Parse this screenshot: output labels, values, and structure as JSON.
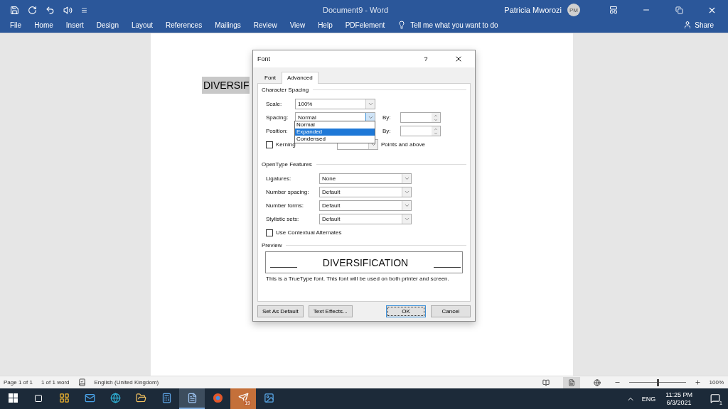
{
  "title_bar": {
    "title": "Document9  -  Word",
    "user": "Patricia Mworozi",
    "avatar": "PM"
  },
  "ribbon_tabs": [
    {
      "label": "File"
    },
    {
      "label": "Home"
    },
    {
      "label": "Insert"
    },
    {
      "label": "Design"
    },
    {
      "label": "Layout"
    },
    {
      "label": "References"
    },
    {
      "label": "Mailings"
    },
    {
      "label": "Review"
    },
    {
      "label": "View"
    },
    {
      "label": "Help"
    },
    {
      "label": "PDFelement"
    }
  ],
  "tell_me": "Tell me what you want to do",
  "share": "Share",
  "document": {
    "text": "DIVERSIF"
  },
  "dialog": {
    "title": "Font",
    "help": "?",
    "tabs": [
      {
        "label": "Font",
        "selected": false
      },
      {
        "label": "Advanced",
        "selected": true
      }
    ],
    "character_spacing": {
      "heading": "Character Spacing",
      "scale": {
        "label": "Scale:",
        "value": "100%"
      },
      "spacing": {
        "label": "Spacing:",
        "value": "Normal",
        "by_label": "By:",
        "expanded": true
      },
      "position": {
        "label": "Position:",
        "by_label": "By:"
      },
      "kerning": {
        "label": "Kerning",
        "checked": false,
        "suffix": "Points and above"
      },
      "spacing_options": [
        {
          "label": "Normal",
          "selected": false
        },
        {
          "label": "Expanded",
          "selected": true
        },
        {
          "label": "Condensed",
          "selected": false
        }
      ]
    },
    "opentype": {
      "heading": "OpenType Features",
      "fields": [
        {
          "label": "Ligatures:",
          "value": "None"
        },
        {
          "label": "Number spacing:",
          "value": "Default"
        },
        {
          "label": "Number forms:",
          "value": "Default"
        },
        {
          "label": "Stylistic sets:",
          "value": "Default"
        }
      ],
      "contextual": {
        "label": "Use Contextual Alternates",
        "checked": false
      }
    },
    "preview": {
      "heading": "Preview",
      "sample": "DIVERSIFICATION",
      "note": "This is a TrueType font. This font will be used on both printer and screen."
    },
    "buttons": [
      {
        "label": "Set As Default",
        "default": false
      },
      {
        "label": "Text Effects...",
        "default": false
      },
      {
        "label": "OK",
        "default": true
      },
      {
        "label": "Cancel",
        "default": false
      }
    ]
  },
  "status_bar": {
    "page": "Page 1 of 1",
    "words": "1 of 1 word",
    "language": "English (United Kingdom)",
    "views": [
      {
        "selected": false
      },
      {
        "selected": true
      },
      {
        "selected": false
      }
    ],
    "zoom": {
      "level": 0.5,
      "reading": "100%"
    }
  },
  "taskbar": {
    "apps": [
      {
        "kind": "store",
        "active": false
      },
      {
        "kind": "mail",
        "active": false
      },
      {
        "kind": "edge",
        "active": false
      },
      {
        "kind": "files",
        "active": false
      },
      {
        "kind": "calculator",
        "active": false
      },
      {
        "kind": "word",
        "active": true
      },
      {
        "kind": "browser",
        "active": false
      },
      {
        "kind": "chat",
        "active": false,
        "badge": "19"
      },
      {
        "kind": "photos",
        "active": false
      }
    ],
    "language": "ENG",
    "time": "11:25 PM",
    "date": "6/3/2021",
    "notifications": "1"
  }
}
